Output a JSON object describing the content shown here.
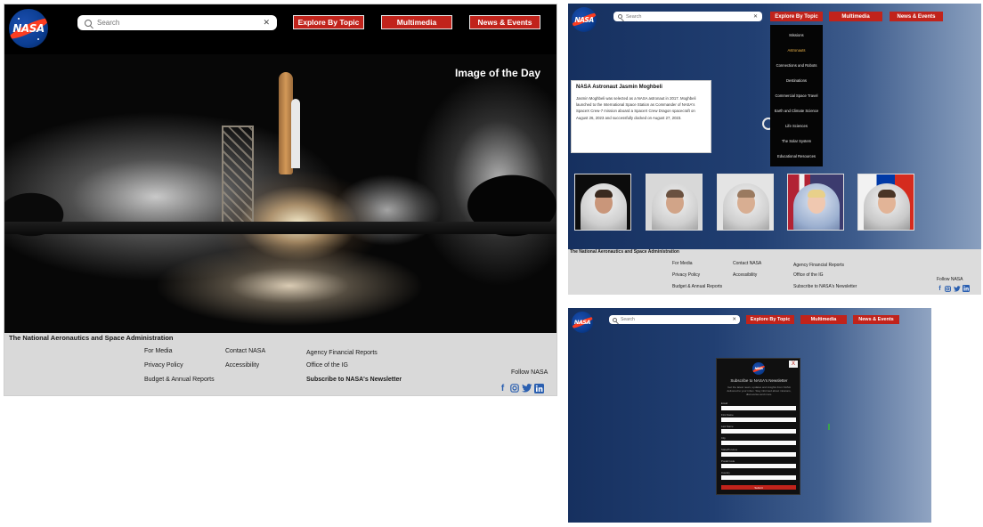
{
  "brand": {
    "logo_text": "NASA"
  },
  "search": {
    "placeholder": "Search",
    "clear": "✕"
  },
  "nav": {
    "explore": "Explore By Topic",
    "multimedia": "Multimedia",
    "news": "News & Events"
  },
  "hero": {
    "caption": "Image of the Day"
  },
  "footer": {
    "title": "The National Aeronautics and Space Administration",
    "col1": [
      "For Media",
      "Privacy Policy",
      "Budget & Annual Reports"
    ],
    "col2": [
      "Contact NASA",
      "Accessibility"
    ],
    "col3": [
      "Agency Financial Reports",
      "Office of the IG",
      "Subscribe to NASA's Newsletter"
    ],
    "follow": "Follow NASA",
    "social_icons": [
      "facebook-icon",
      "instagram-icon",
      "twitter-icon",
      "linkedin-icon"
    ]
  },
  "astronaut_card": {
    "title": "NASA Astronaut Jasmin Moghbeli",
    "body": "Jasmin Moghbeli was selected as a NASA astronaut in 2017. Moghbeli launched to the International Space Station as Commander of NASA's SpaceX Crew-7 mission aboard a SpaceX Crew Dragon spacecraft on August 26, 2023 and successfully docked on August 27, 2023."
  },
  "dropdown": {
    "items": [
      "Missions",
      "Astronauts",
      "Connections and Robots",
      "Destinations",
      "Commercial Space Travel",
      "Earth and Climate Science",
      "Life Sciences",
      "The Solar System",
      "Educational Resources"
    ],
    "active_index": 1
  },
  "newsletter": {
    "close": "X",
    "title": "Subscribe to NASA's Newsletter",
    "desc": "Get the latest news, updates and insights from NASA delivered to your inbox. Stay informed about missions, discoveries and more.",
    "fields": [
      "Email",
      "First Name",
      "Last Name",
      "City",
      "State/Province",
      "Postal Code",
      "Country"
    ],
    "submit": "Submit"
  },
  "colors": {
    "accent_red": "#c1231b",
    "nasa_blue": "#0b3d91",
    "footer_gray": "#d9d9d9"
  }
}
